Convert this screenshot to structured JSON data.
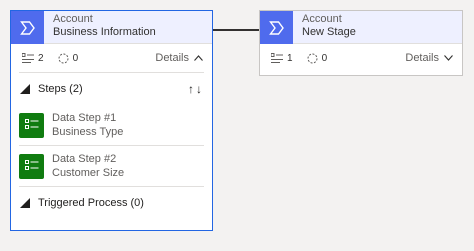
{
  "stages": [
    {
      "entity": "Account",
      "stage_name": "Business Information",
      "steps_count": "2",
      "triggers_count": "0",
      "details_label": "Details",
      "expanded": true,
      "steps_section_label": "Steps (2)",
      "steps": [
        {
          "title": "Data Step #1",
          "field": "Business Type"
        },
        {
          "title": "Data Step #2",
          "field": "Customer Size"
        }
      ],
      "triggered_process_label": "Triggered Process (0)"
    },
    {
      "entity": "Account",
      "stage_name": "New Stage",
      "steps_count": "1",
      "triggers_count": "0",
      "details_label": "Details",
      "expanded": false
    }
  ],
  "colors": {
    "stage_icon": "#4f6bed",
    "step_icon": "#107c10",
    "selected_border": "#2266e3",
    "header_bg": "#eef0ff"
  },
  "icons": {
    "stage": "chevron-stage-icon",
    "steps": "steps-list-icon",
    "triggers": "dashed-circle-icon",
    "step": "data-step-icon"
  }
}
